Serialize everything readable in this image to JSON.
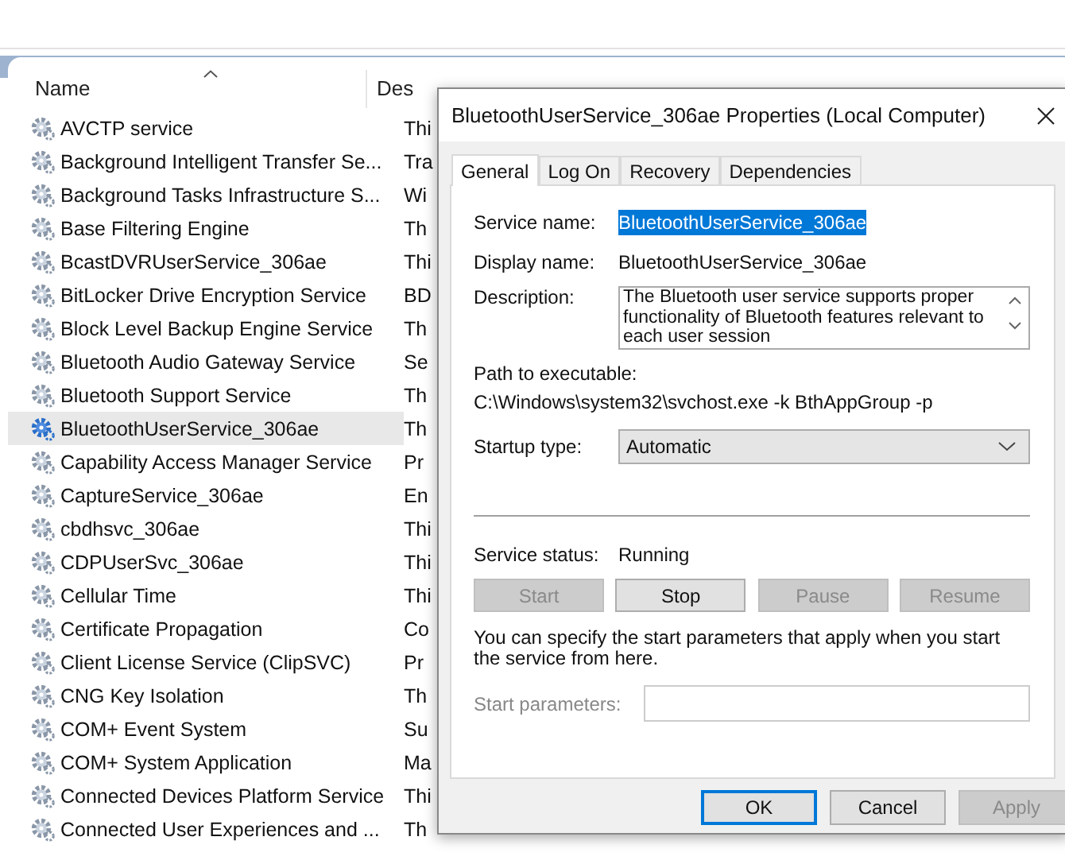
{
  "services_list": {
    "columns": [
      {
        "label": "Name",
        "sorted": true
      },
      {
        "label": "Des",
        "sorted": false
      }
    ],
    "rows": [
      {
        "name": "AVCTP service",
        "description": "Thi",
        "selected": false
      },
      {
        "name": "Background Intelligent Transfer Se...",
        "description": "Tra",
        "selected": false
      },
      {
        "name": "Background Tasks Infrastructure S...",
        "description": "Wi",
        "selected": false
      },
      {
        "name": "Base Filtering Engine",
        "description": "Th",
        "selected": false
      },
      {
        "name": "BcastDVRUserService_306ae",
        "description": "Thi",
        "selected": false
      },
      {
        "name": "BitLocker Drive Encryption Service",
        "description": "BD",
        "selected": false
      },
      {
        "name": "Block Level Backup Engine Service",
        "description": "Th",
        "selected": false
      },
      {
        "name": "Bluetooth Audio Gateway Service",
        "description": "Se",
        "selected": false
      },
      {
        "name": "Bluetooth Support Service",
        "description": "Th",
        "selected": false
      },
      {
        "name": "BluetoothUserService_306ae",
        "description": "Th",
        "selected": true
      },
      {
        "name": "Capability Access Manager Service",
        "description": "Pr",
        "selected": false
      },
      {
        "name": "CaptureService_306ae",
        "description": "En",
        "selected": false
      },
      {
        "name": "cbdhsvc_306ae",
        "description": "Thi",
        "selected": false
      },
      {
        "name": "CDPUserSvc_306ae",
        "description": "Thi",
        "selected": false
      },
      {
        "name": "Cellular Time",
        "description": "Thi",
        "selected": false
      },
      {
        "name": "Certificate Propagation",
        "description": "Co",
        "selected": false
      },
      {
        "name": "Client License Service (ClipSVC)",
        "description": "Pr",
        "selected": false
      },
      {
        "name": "CNG Key Isolation",
        "description": "Th",
        "selected": false
      },
      {
        "name": "COM+ Event System",
        "description": "Su",
        "selected": false
      },
      {
        "name": "COM+ System Application",
        "description": "Ma",
        "selected": false
      },
      {
        "name": "Connected Devices Platform Service",
        "description": "Thi",
        "selected": false
      },
      {
        "name": "Connected User Experiences and ...",
        "description": "Th",
        "selected": false
      }
    ]
  },
  "dialog": {
    "title": "BluetoothUserService_306ae Properties (Local Computer)",
    "tabs": [
      {
        "label": "General",
        "selected": true
      },
      {
        "label": "Log On",
        "selected": false
      },
      {
        "label": "Recovery",
        "selected": false
      },
      {
        "label": "Dependencies",
        "selected": false
      }
    ],
    "service_name": {
      "label": "Service name:",
      "value": "BluetoothUserService_306ae",
      "selected": true
    },
    "display_name": {
      "label": "Display name:",
      "value": "BluetoothUserService_306ae"
    },
    "description": {
      "label": "Description:",
      "value": "The Bluetooth user service supports proper functionality of Bluetooth features relevant to each user session"
    },
    "path": {
      "label": "Path to executable:",
      "value": "C:\\Windows\\system32\\svchost.exe -k BthAppGroup -p"
    },
    "startup_type": {
      "label": "Startup type:",
      "value": "Automatic"
    },
    "status": {
      "label": "Service status:",
      "value": "Running"
    },
    "controls": [
      {
        "label": "Start",
        "disabled": true
      },
      {
        "label": "Stop",
        "disabled": false
      },
      {
        "label": "Pause",
        "disabled": true
      },
      {
        "label": "Resume",
        "disabled": true
      }
    ],
    "hint": "You can specify the start parameters that apply when you start the service from here.",
    "start_parameters": {
      "label": "Start parameters:",
      "disabled": true
    },
    "buttons": [
      {
        "label": "OK",
        "default": true,
        "disabled": false
      },
      {
        "label": "Cancel",
        "default": false,
        "disabled": false
      },
      {
        "label": "Apply",
        "default": false,
        "disabled": true
      }
    ]
  }
}
